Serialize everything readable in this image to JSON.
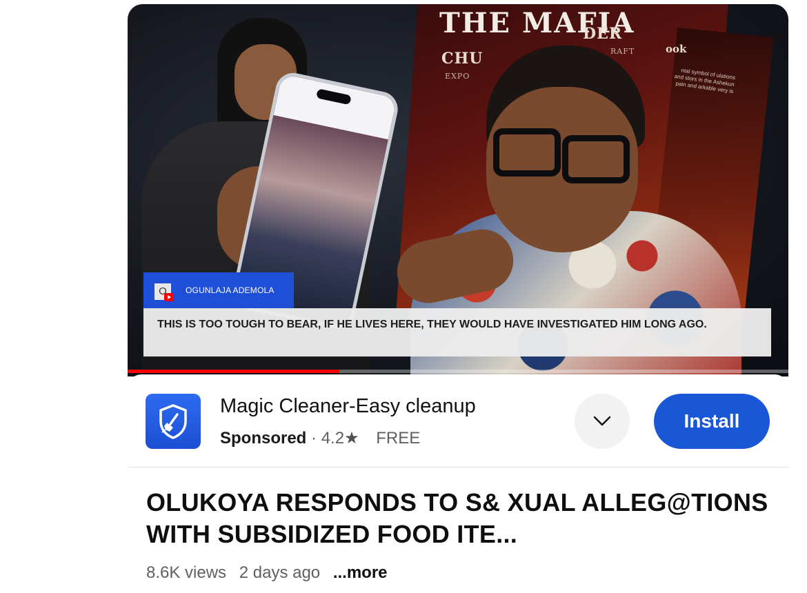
{
  "video": {
    "book_title": "THE MAFIA",
    "book_subtitle": "CHU",
    "book_subtitle_right": "DER",
    "book_tag": "EXPO",
    "book_tag_right": "RAFT",
    "book_side": "ook",
    "book_blurb": "ntal symbol of ulations and stors in the Ashekun pain and arkable very is",
    "channel_avatar_letter": "O",
    "channel_name": "OGUNLAJA ADEMOLA",
    "caption": "THIS IS TOO TOUGH TO BEAR, IF HE LIVES HERE, THEY WOULD HAVE INVESTIGATED HIM LONG AGO.",
    "progress_fraction": 0.32
  },
  "ad": {
    "app_name": "Magic Cleaner-Easy cleanup",
    "sponsored_label": "Sponsored",
    "separator": "·",
    "rating": "4.2",
    "price": "FREE",
    "install_label": "Install",
    "icon": "shield-broom-icon",
    "accent_color": "#1a57d6"
  },
  "meta": {
    "title": "OLUKOYA RESPONDS TO S& XUAL ALLEG@TIONS WITH SUBSIDIZED FOOD ITE...",
    "views": "8.6K views",
    "age": "2 days ago",
    "more_label": "...more"
  }
}
